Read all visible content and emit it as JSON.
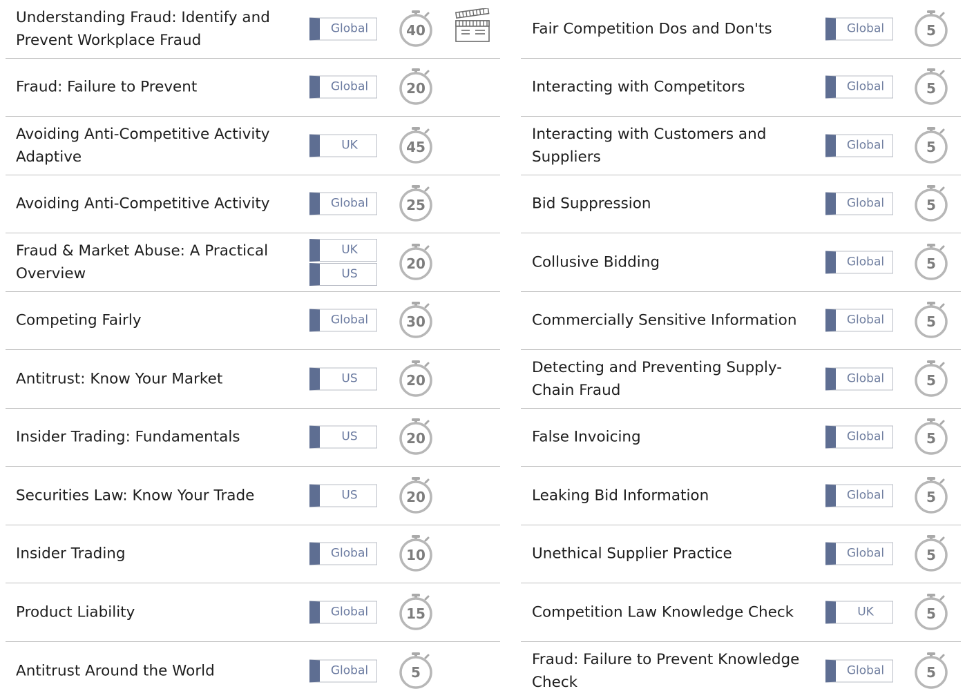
{
  "left_column": [
    {
      "title": "Understanding Fraud: Identify and Prevent Workplace Fraud",
      "regions": [
        "Global"
      ],
      "minutes": "40",
      "has_video": true
    },
    {
      "title": "Fraud: Failure to Prevent",
      "regions": [
        "Global"
      ],
      "minutes": "20"
    },
    {
      "title": "Avoiding Anti-Competitive Activity Adaptive",
      "regions": [
        "UK"
      ],
      "minutes": "45"
    },
    {
      "title": "Avoiding Anti-Competitive Activity",
      "regions": [
        "Global"
      ],
      "minutes": "25"
    },
    {
      "title": "Fraud & Market Abuse: A Practical Overview",
      "regions": [
        "UK",
        "US"
      ],
      "minutes": "20"
    },
    {
      "title": "Competing Fairly",
      "regions": [
        "Global"
      ],
      "minutes": "30"
    },
    {
      "title": "Antitrust: Know Your Market",
      "regions": [
        "US"
      ],
      "minutes": "20"
    },
    {
      "title": "Insider Trading: Fundamentals",
      "regions": [
        "US"
      ],
      "minutes": "20"
    },
    {
      "title": "Securities Law: Know Your Trade",
      "regions": [
        "US"
      ],
      "minutes": "20"
    },
    {
      "title": "Insider Trading",
      "regions": [
        "Global"
      ],
      "minutes": "10"
    },
    {
      "title": "Product Liability",
      "regions": [
        "Global"
      ],
      "minutes": "15"
    },
    {
      "title": "Antitrust Around the World",
      "regions": [
        "Global"
      ],
      "minutes": "5"
    }
  ],
  "right_column": [
    {
      "title": "Fair Competition Dos and Don'ts",
      "regions": [
        "Global"
      ],
      "minutes": "5"
    },
    {
      "title": "Interacting with Competitors",
      "regions": [
        "Global"
      ],
      "minutes": "5"
    },
    {
      "title": "Interacting with Customers and Suppliers",
      "regions": [
        "Global"
      ],
      "minutes": "5"
    },
    {
      "title": "Bid Suppression",
      "regions": [
        "Global"
      ],
      "minutes": "5"
    },
    {
      "title": "Collusive Bidding",
      "regions": [
        "Global"
      ],
      "minutes": "5"
    },
    {
      "title": "Commercially Sensitive Information",
      "regions": [
        "Global"
      ],
      "minutes": "5"
    },
    {
      "title": "Detecting and Preventing Supply-Chain Fraud",
      "regions": [
        "Global"
      ],
      "minutes": "5"
    },
    {
      "title": "False Invoicing",
      "regions": [
        "Global"
      ],
      "minutes": "5"
    },
    {
      "title": "Leaking Bid Information",
      "regions": [
        "Global"
      ],
      "minutes": "5"
    },
    {
      "title": "Unethical Supplier Practice",
      "regions": [
        "Global"
      ],
      "minutes": "5"
    },
    {
      "title": "Competition Law Knowledge Check",
      "regions": [
        "UK"
      ],
      "minutes": "5"
    },
    {
      "title": "Fraud: Failure to Prevent Knowledge Check",
      "regions": [
        "Global"
      ],
      "minutes": "5"
    }
  ],
  "icons": {
    "timer": "stopwatch-icon",
    "video": "film-clapperboard-icon"
  },
  "colors": {
    "badge_accent": "#5e6e92",
    "badge_text": "#6a7aa0",
    "badge_border": "#b9bdc6",
    "timer_gray": "#7d7d7d",
    "divider": "#bdbdbd"
  }
}
